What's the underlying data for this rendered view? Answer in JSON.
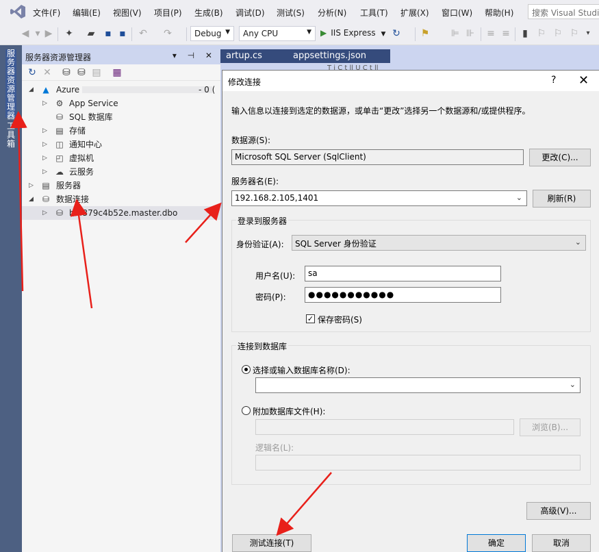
{
  "menubar": {
    "items": [
      "文件(F)",
      "编辑(E)",
      "视图(V)",
      "项目(P)",
      "生成(B)",
      "调试(D)",
      "测试(S)",
      "分析(N)",
      "工具(T)",
      "扩展(X)",
      "窗口(W)",
      "帮助(H)"
    ],
    "search_placeholder": "搜索 Visual Studio"
  },
  "toolbar": {
    "config": "Debug",
    "platform": "Any CPU",
    "run_target": "IIS Express"
  },
  "vertical_tabs": {
    "server_explorer": "服务器资源管理器",
    "toolbox": "工具箱"
  },
  "explorer": {
    "title": "服务器资源管理器",
    "pane_controls": "▾ ⊣ ✕",
    "tree": {
      "azure": "Azure",
      "azure_suffix": "- 0 (",
      "app_service": "App Service",
      "sql_db": "SQL 数据库",
      "storage": "存储",
      "notification_hub": "通知中心",
      "vm": "虚拟机",
      "cloud_service": "云服务",
      "servers": "服务器",
      "data_connections": "数据连接",
      "connection": "b7f379c4b52e.master.dbo"
    }
  },
  "doc_tabs": {
    "tab1": "artup.cs",
    "tab2": "appsettings.json",
    "breadcrumb": "T    i  C  t  ll  U  C  t  ll"
  },
  "dialog": {
    "title": "修改连接",
    "help": "?",
    "close": "✕",
    "instructions": "输入信息以连接到选定的数据源，或单击“更改”选择另一个数据源和/或提供程序。",
    "datasource_label": "数据源(S):",
    "datasource_value": "Microsoft SQL Server (SqlClient)",
    "change_button": "更改(C)...",
    "server_label": "服务器名(E):",
    "server_value": "192.168.2.105,1401",
    "refresh_button": "刷新(R)",
    "login_group": "登录到服务器",
    "auth_label": "身份验证(A):",
    "auth_value": "SQL Server 身份验证",
    "username_label": "用户名(U):",
    "username_value": "sa",
    "password_label": "密码(P):",
    "password_value": "●●●●●●●●●●●",
    "save_password_label": "保存密码(S)",
    "save_password_checked": true,
    "db_group": "连接到数据库",
    "select_db_label": "选择或输入数据库名称(D):",
    "select_db_value": "",
    "attach_db_label": "附加数据库文件(H):",
    "attach_db_value": "",
    "browse_button": "浏览(B)...",
    "logical_name_label": "逻辑名(L):",
    "logical_name_value": "",
    "advanced_button": "高级(V)...",
    "test_button": "测试连接(T)",
    "ok_button": "确定",
    "cancel_button": "取消"
  },
  "colors": {
    "annotation_arrow": "#E8201A",
    "accent_blue": "#0078D7",
    "vs_purple": "#68217A"
  }
}
